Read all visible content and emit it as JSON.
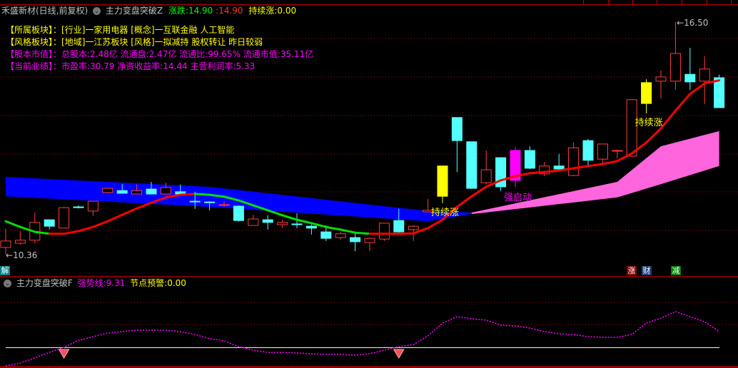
{
  "header": {
    "stock_title": "禾盛新材(日线,前复权)",
    "indicator_name": "主力变盘突破Z",
    "change_label": "涨跌:",
    "change_value_green": "14.90",
    "change_value_red": "14.90",
    "sustain_label": "持续涨:",
    "sustain_value": "0.00"
  },
  "info": [
    {
      "key": "【所属板块】：",
      "value": "[行业]一家用电器 [概念]一互联金融 人工智能",
      "color": "#ffff00"
    },
    {
      "key": "【风格板块】：",
      "value": "[地域]一江苏板块 [风格]一拟减持 股权转让 昨日较弱",
      "color": "#ffff00"
    },
    {
      "key": "【股本市值】：",
      "value": "总股本:2.48亿 流通盘:2.47亿 流通比:99.65% 流通市值:35.11亿",
      "color": "#ff00ff"
    },
    {
      "key": "【当前业绩】：",
      "value": "市盈率:30.79 净资收益率:14.44 主营利润率:5.33",
      "color": "#ff00ff"
    }
  ],
  "price_labels": {
    "low": "10.36",
    "high": "16.50"
  },
  "signals": [
    {
      "index": 30,
      "text": "持续涨",
      "color": "#ffff00",
      "where": "below"
    },
    {
      "index": 44,
      "text": "持续涨",
      "color": "#ffff00",
      "where": "below"
    },
    {
      "index": 35,
      "text": "强启动",
      "color": "#ff00ff",
      "where": "below-band"
    }
  ],
  "badges": {
    "left": {
      "text": "解",
      "color": "#008080"
    },
    "right": [
      {
        "text": "涨",
        "color": "#800000"
      },
      {
        "text": "财",
        "color": "#1f3f7a"
      },
      {
        "text": "减",
        "color": "#008000"
      }
    ]
  },
  "lower": {
    "indicator_name": "主力变盘突破F",
    "strong_label": "强势线:",
    "strong_value": "9.31",
    "node_label": "节点预警:",
    "node_value": "0.00"
  },
  "colors": {
    "up": "#ff3b3b",
    "down": "#54ffff",
    "ma_up": "#ff0000",
    "ma_down": "#00e000",
    "band_blue": "#0000ff",
    "band_pink": "#ff66dd",
    "strong_line": "#ff00ff",
    "grid": "#a00000"
  },
  "chart_data": [
    {
      "type": "candlestick",
      "ylim": [
        10.36,
        16.5
      ],
      "candles": [
        [
          10.55,
          10.72,
          11.04,
          10.36,
          "r"
        ],
        [
          10.66,
          10.74,
          10.98,
          10.62,
          "r"
        ],
        [
          10.74,
          11.21,
          11.47,
          10.66,
          "r"
        ],
        [
          11.28,
          11.11,
          11.28,
          11.02,
          "c"
        ],
        [
          11.06,
          11.6,
          11.62,
          11.06,
          "r"
        ],
        [
          11.62,
          11.6,
          11.66,
          11.58,
          "c"
        ],
        [
          11.51,
          11.77,
          11.77,
          11.38,
          "r"
        ],
        [
          12.0,
          12.11,
          12.11,
          11.98,
          "r"
        ],
        [
          12.05,
          11.98,
          12.22,
          11.98,
          "c"
        ],
        [
          11.96,
          12.05,
          12.21,
          11.96,
          "r"
        ],
        [
          12.09,
          11.96,
          12.28,
          11.96,
          "c"
        ],
        [
          11.96,
          12.13,
          12.26,
          11.96,
          "r"
        ],
        [
          12.02,
          11.96,
          12.21,
          11.96,
          "c"
        ],
        [
          11.77,
          11.75,
          12.02,
          11.57,
          "c"
        ],
        [
          11.75,
          11.73,
          11.77,
          11.53,
          "c"
        ],
        [
          11.66,
          11.68,
          11.77,
          11.62,
          "r"
        ],
        [
          11.64,
          11.26,
          11.66,
          11.23,
          "c"
        ],
        [
          11.13,
          11.3,
          11.41,
          11.13,
          "r"
        ],
        [
          11.28,
          11.21,
          11.4,
          11.02,
          "c"
        ],
        [
          11.15,
          11.21,
          11.28,
          11.06,
          "r"
        ],
        [
          11.17,
          11.15,
          11.45,
          11.06,
          "c"
        ],
        [
          11.11,
          11.06,
          11.15,
          10.89,
          "c"
        ],
        [
          10.96,
          10.79,
          11.13,
          10.72,
          "c"
        ],
        [
          10.81,
          10.91,
          10.96,
          10.76,
          "r"
        ],
        [
          10.81,
          10.7,
          10.96,
          10.45,
          "c"
        ],
        [
          10.68,
          10.79,
          10.81,
          10.45,
          "r"
        ],
        [
          10.77,
          11.19,
          11.19,
          10.72,
          "r"
        ],
        [
          11.26,
          10.96,
          11.57,
          10.92,
          "c"
        ],
        [
          11.02,
          11.11,
          11.13,
          10.72,
          "r"
        ],
        [
          11.49,
          11.53,
          11.83,
          11.49,
          "r"
        ],
        [
          11.9,
          12.7,
          12.7,
          11.72,
          "y"
        ],
        [
          13.98,
          13.37,
          13.98,
          12.54,
          "c"
        ],
        [
          13.34,
          12.11,
          13.34,
          12.09,
          "c"
        ],
        [
          12.26,
          12.6,
          13.11,
          12.21,
          "r"
        ],
        [
          12.92,
          12.15,
          12.92,
          12.04,
          "c"
        ],
        [
          12.32,
          13.11,
          13.2,
          12.15,
          "m"
        ],
        [
          13.11,
          12.64,
          13.22,
          12.62,
          "c"
        ],
        [
          12.49,
          12.7,
          12.81,
          12.43,
          "r"
        ],
        [
          12.7,
          12.62,
          13.02,
          12.6,
          "c"
        ],
        [
          12.45,
          13.18,
          13.32,
          12.43,
          "r"
        ],
        [
          13.37,
          12.85,
          13.41,
          12.73,
          "c"
        ],
        [
          12.88,
          13.28,
          13.28,
          12.73,
          "r"
        ],
        [
          13.09,
          13.11,
          13.13,
          12.9,
          "r"
        ],
        [
          12.96,
          14.45,
          14.45,
          12.94,
          "r"
        ],
        [
          14.35,
          14.9,
          14.99,
          14.09,
          "y"
        ],
        [
          14.94,
          15.05,
          15.22,
          14.48,
          "r"
        ],
        [
          14.94,
          15.67,
          16.5,
          14.71,
          "r"
        ],
        [
          15.12,
          14.92,
          15.82,
          14.71,
          "c"
        ],
        [
          14.94,
          15.26,
          15.6,
          14.33,
          "r"
        ],
        [
          15.03,
          14.24,
          15.11,
          14.24,
          "c"
        ]
      ],
      "ma_line": [
        11.24,
        11.09,
        10.96,
        10.91,
        10.91,
        10.98,
        11.09,
        11.24,
        11.41,
        11.58,
        11.73,
        11.87,
        11.94,
        11.96,
        11.94,
        11.89,
        11.79,
        11.66,
        11.53,
        11.4,
        11.28,
        11.19,
        11.09,
        11.02,
        10.94,
        10.91,
        10.91,
        10.91,
        10.92,
        11.06,
        11.28,
        11.62,
        11.9,
        12.15,
        12.32,
        12.43,
        12.51,
        12.54,
        12.58,
        12.64,
        12.7,
        12.75,
        12.83,
        13.03,
        13.32,
        13.69,
        14.16,
        14.6,
        14.88,
        14.96
      ],
      "band_blue": {
        "points": [
          [
            0,
            12.41,
            11.9
          ],
          [
            14,
            12.15,
            11.62
          ],
          [
            29,
            11.51,
            11.24
          ],
          [
            32,
            11.47,
            11.43
          ]
        ]
      },
      "band_pink": {
        "points": [
          [
            32,
            11.47,
            11.43
          ],
          [
            42,
            12.28,
            11.87
          ],
          [
            45,
            13.22,
            12.22
          ],
          [
            49,
            13.62,
            12.7
          ]
        ]
      }
    },
    {
      "type": "line",
      "series": [
        {
          "name": "强势线",
          "values": [
            -11.0,
            -9.3,
            -6.3,
            -3.0,
            0,
            4.2,
            6.3,
            8.5,
            9.3,
            10.2,
            10.2,
            10.2,
            9.3,
            7.6,
            5.1,
            3.8,
            0.4,
            -1.7,
            -3.0,
            -3.0,
            -3.4,
            -3.8,
            -4.2,
            -4.2,
            -4.7,
            -3.8,
            -1.7,
            0.4,
            1.7,
            6.8,
            14.4,
            18.2,
            16.9,
            16.1,
            13.1,
            12.7,
            11.4,
            9.3,
            8.0,
            7.6,
            6.3,
            5.9,
            5.9,
            7.6,
            14.4,
            17.3,
            21.2,
            18.2,
            15.2,
            9.31
          ]
        }
      ],
      "reference_level": 0,
      "alerts": [
        4,
        27
      ]
    }
  ]
}
